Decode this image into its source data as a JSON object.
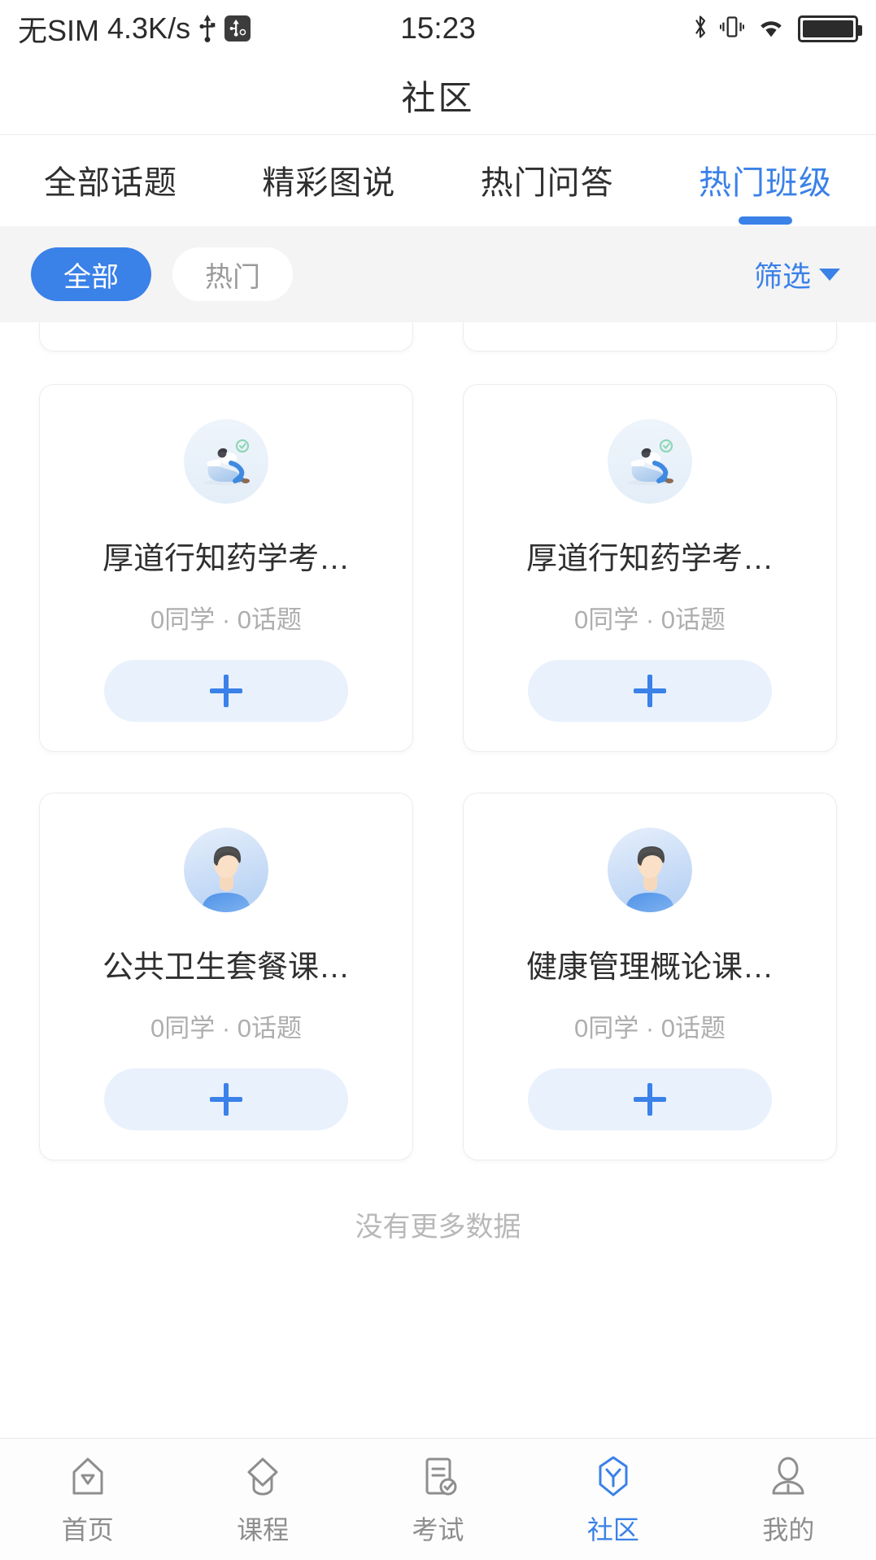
{
  "statusbar": {
    "carrier": "无SIM",
    "network_speed": "4.3K/s",
    "time": "15:23",
    "icons": [
      "usb-icon",
      "usb-debug-icon",
      "bluetooth-icon",
      "vibrate-icon",
      "wifi-icon",
      "battery-icon"
    ]
  },
  "header": {
    "title": "社区"
  },
  "tabs": [
    {
      "label": "全部话题",
      "active": false
    },
    {
      "label": "精彩图说",
      "active": false
    },
    {
      "label": "热门问答",
      "active": false
    },
    {
      "label": "热门班级",
      "active": true
    }
  ],
  "filterbar": {
    "pills": [
      {
        "label": "全部",
        "selected": true
      },
      {
        "label": "热门",
        "selected": false
      }
    ],
    "filter_label": "筛选",
    "accent_color": "#3a81e8",
    "background": "#f4f4f5"
  },
  "cards": [
    {
      "title": "厚道行知药学考…",
      "meta": "0同学 · 0话题",
      "avatar": "person-reading-illustration-avatar",
      "join_label": "plus-icon"
    },
    {
      "title": "厚道行知药学考…",
      "meta": "0同学 · 0话题",
      "avatar": "person-reading-illustration-avatar",
      "join_label": "plus-icon"
    },
    {
      "title": "公共卫生套餐课…",
      "meta": "0同学 · 0话题",
      "avatar": "default-person-avatar",
      "join_label": "plus-icon"
    },
    {
      "title": "健康管理概论课…",
      "meta": "0同学 · 0话题",
      "avatar": "default-person-avatar",
      "join_label": "plus-icon"
    }
  ],
  "footer_text": "没有更多数据",
  "bottomnav": [
    {
      "label": "首页",
      "icon": "home-icon",
      "active": false
    },
    {
      "label": "课程",
      "icon": "graduation-cap-icon",
      "active": false
    },
    {
      "label": "考试",
      "icon": "document-check-icon",
      "active": false
    },
    {
      "label": "社区",
      "icon": "community-hexagon-icon",
      "active": true
    },
    {
      "label": "我的",
      "icon": "person-icon",
      "active": false
    }
  ]
}
